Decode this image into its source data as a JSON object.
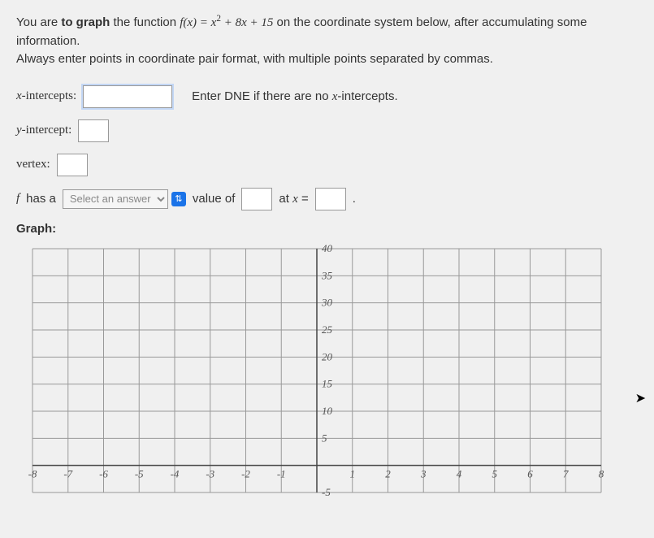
{
  "instructions": {
    "line1_prefix": "You are ",
    "line1_bold": "to graph",
    "line1_mid": " the function ",
    "line1_func": "f(x) = x² + 8x + 15",
    "line1_suffix": " on the coordinate system below, after accumulating some information.",
    "line2": "Always enter points in coordinate pair format, with multiple points separated by commas."
  },
  "fields": {
    "x_intercepts_label": "x-intercepts:",
    "x_intercepts_hint": "Enter DNE if there are no x-intercepts.",
    "y_intercept_label": "y-intercept:",
    "vertex_label": "vertex:",
    "has_prefix": "f has a",
    "select_placeholder": "Select an answer",
    "value_of": "value of",
    "at_x": "at x =",
    "period": "."
  },
  "graph": {
    "label": "Graph:",
    "x_ticks": [
      -8,
      -7,
      -6,
      -5,
      -4,
      -3,
      -2,
      -1,
      1,
      2,
      3,
      4,
      5,
      6,
      7,
      8
    ],
    "y_ticks_pos": [
      5,
      10,
      15,
      20,
      25,
      30,
      35,
      40
    ],
    "y_ticks_neg": [
      -5
    ]
  },
  "chart_data": {
    "type": "line",
    "title": "",
    "xlabel": "",
    "ylabel": "",
    "xlim": [
      -8,
      8
    ],
    "ylim": [
      -5,
      40
    ],
    "series": []
  }
}
